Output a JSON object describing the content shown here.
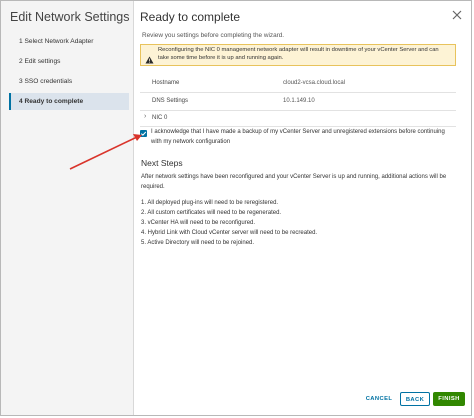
{
  "sidebar": {
    "title": "Edit Network Settings",
    "steps": [
      {
        "label": "1  Select Network Adapter"
      },
      {
        "label": "2  Edit settings"
      },
      {
        "label": "3  SSO credentials"
      },
      {
        "label": "4  Ready to complete"
      }
    ],
    "active_step": 3
  },
  "main": {
    "title": "Ready to complete",
    "subtitle": "Review you settings before completing the wizard.",
    "warning": "Reconfiguring the NIC 0 management network adapter will result in downtime of your vCenter Server and can take some time before it is up and running again.",
    "settings": [
      {
        "label": "Hostname",
        "value": "cloud2-vcsa.cloud.local"
      },
      {
        "label": "DNS Settings",
        "value": "10.1.149.10"
      }
    ],
    "nic_label": "NIC 0",
    "acknowledge": {
      "checked": true,
      "text": "I acknowledge that I have made a backup of my vCenter Server and unregistered extensions before continuing with my network configuration"
    },
    "next_steps": {
      "heading": "Next Steps",
      "intro": "After network settings have been reconfigured and your vCenter Server is up and running, additional actions will be required.",
      "items": [
        "1. All deployed plug-ins will need to be reregistered.",
        "2. All custom certificates will need to be regenerated.",
        "3. vCenter HA will need to be reconfigured.",
        "4. Hybrid Link with Cloud vCenter server will need to be recreated.",
        "5. Active Directory will need to be rejoined."
      ]
    }
  },
  "footer": {
    "cancel": "CANCEL",
    "back": "BACK",
    "finish": "FINISH"
  },
  "colors": {
    "accent": "#0072a3",
    "finish": "#318700",
    "warning_bg": "#fdf3d5",
    "annotation_arrow": "#d9342b"
  },
  "icons": {
    "close": "close-icon",
    "warning": "warning-icon",
    "chevron": "chevron-right-icon",
    "checkbox": "checkmark-icon"
  }
}
